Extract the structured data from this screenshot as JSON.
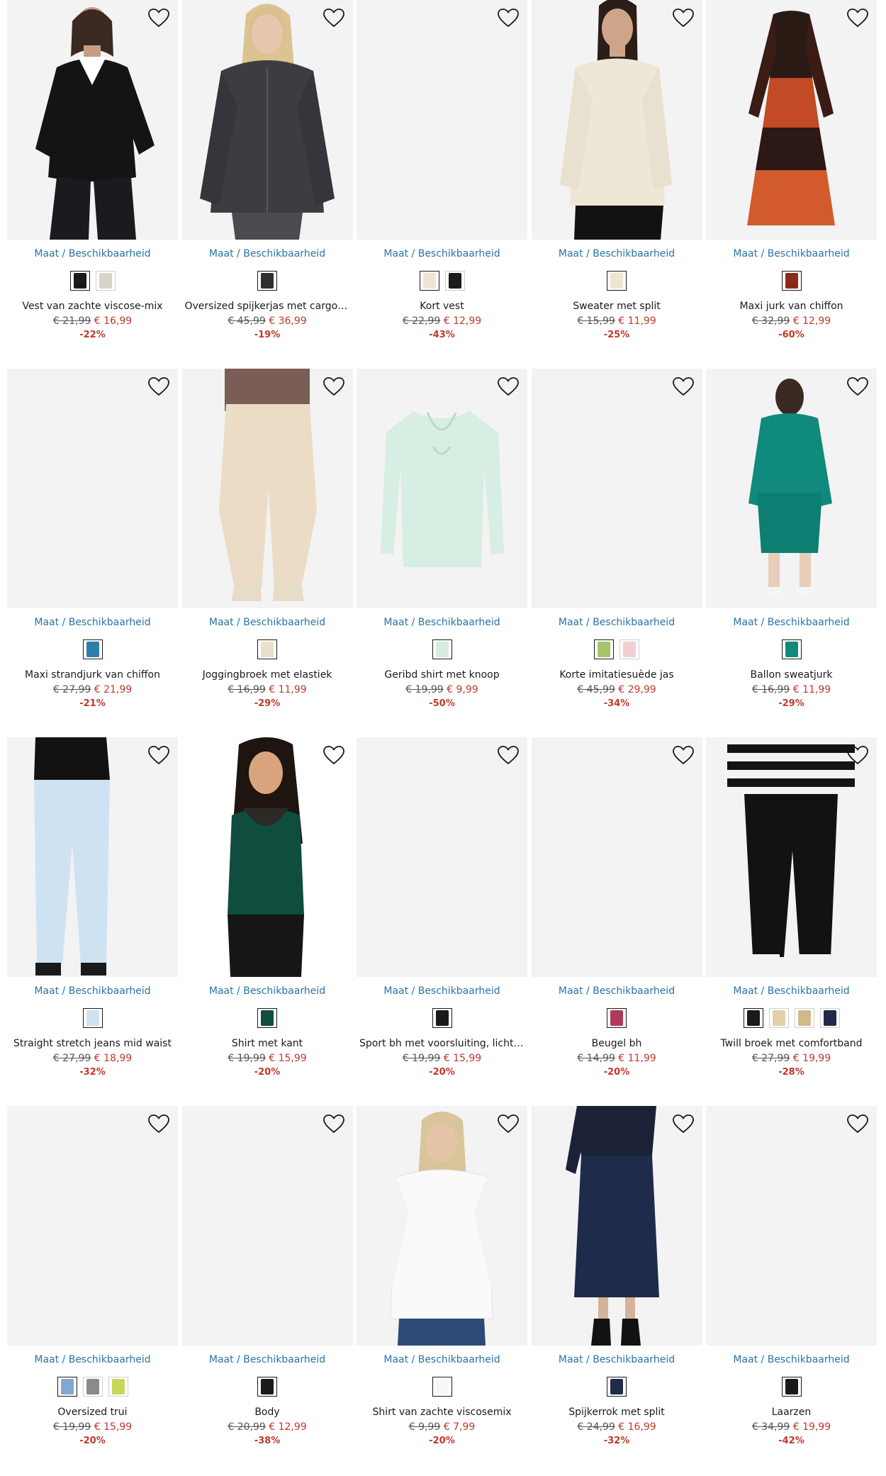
{
  "common": {
    "size_link": "Maat / Beschikbaarheid"
  },
  "products": [
    {
      "title": "Vest van zachte viscose-mix",
      "old": "€ 21,99",
      "new": "€ 16,99",
      "discount": "-22%",
      "swatches": [
        "#1a1a1a",
        "#d9d4c8"
      ],
      "photo": "cardigan-black",
      "bg": "#f3f3f3"
    },
    {
      "title": "Oversized spijkerjas met cargodetails",
      "old": "€ 45,99",
      "new": "€ 36,99",
      "discount": "-19%",
      "swatches": [
        "#2e2e30"
      ],
      "photo": "denim-jacket",
      "bg": "#f3f3f3"
    },
    {
      "title": "Kort vest",
      "old": "€ 22,99",
      "new": "€ 12,99",
      "discount": "-43%",
      "swatches": [
        "#efe4cf",
        "#1a1a1a"
      ],
      "photo": "empty",
      "bg": "#f3f3f3"
    },
    {
      "title": "Sweater met split",
      "old": "€ 15,99",
      "new": "€ 11,99",
      "discount": "-25%",
      "swatches": [
        "#eee6d2"
      ],
      "photo": "sweater-cream",
      "bg": "#f3f3f3"
    },
    {
      "title": "Maxi jurk van chiffon",
      "old": "€ 32,99",
      "new": "€ 12,99",
      "discount": "-60%",
      "swatches": [
        "#8b2a16"
      ],
      "photo": "maxi-dress-red",
      "bg": "#f3f3f3"
    },
    {
      "title": "Maxi strandjurk van chiffon",
      "old": "€ 27,99",
      "new": "€ 21,99",
      "discount": "-21%",
      "swatches": [
        "#2f7ea8"
      ],
      "photo": "empty",
      "bg": "#f3f3f3"
    },
    {
      "title": "Joggingbroek met elastiek",
      "old": "€ 16,99",
      "new": "€ 11,99",
      "discount": "-29%",
      "swatches": [
        "#eadfcc"
      ],
      "photo": "jogging-beige",
      "bg": "#f3f3f3"
    },
    {
      "title": "Geribd shirt met knoop",
      "old": "€ 19,99",
      "new": "€ 9,99",
      "discount": "-50%",
      "swatches": [
        "#d6ede0"
      ],
      "photo": "mint-shirt",
      "bg": "#f3f3f3"
    },
    {
      "title": "Korte imitatiesuède jas",
      "old": "€ 45,99",
      "new": "€ 29,99",
      "discount": "-34%",
      "swatches": [
        "#a8c46a",
        "#f2cfd2"
      ],
      "photo": "empty",
      "bg": "#f3f3f3"
    },
    {
      "title": "Ballon sweatjurk",
      "old": "€ 16,99",
      "new": "€ 11,99",
      "discount": "-29%",
      "swatches": [
        "#0f8a7c"
      ],
      "photo": "teal-dress",
      "bg": "#f3f3f3"
    },
    {
      "title": "Straight stretch jeans mid waist",
      "old": "€ 27,99",
      "new": "€ 18,99",
      "discount": "-32%",
      "swatches": [
        "#cfe2f2"
      ],
      "photo": "jeans-light",
      "bg": "#f3f3f3"
    },
    {
      "title": "Shirt met kant",
      "old": "€ 19,99",
      "new": "€ 15,99",
      "discount": "-20%",
      "swatches": [
        "#0f4d3f"
      ],
      "photo": "lace-top",
      "bg": "#ffffff"
    },
    {
      "title": "Sport bh met voorsluiting, lichte steun",
      "old": "€ 19,99",
      "new": "€ 15,99",
      "discount": "-20%",
      "swatches": [
        "#1a1a1a"
      ],
      "photo": "empty",
      "bg": "#f3f3f3"
    },
    {
      "title": "Beugel bh",
      "old": "€ 14,99",
      "new": "€ 11,99",
      "discount": "-20%",
      "swatches": [
        "#b03a5c"
      ],
      "photo": "empty",
      "bg": "#f3f3f3"
    },
    {
      "title": "Twill broek met comfortband",
      "old": "€ 27,99",
      "new": "€ 19,99",
      "discount": "-28%",
      "swatches": [
        "#1a1a1a",
        "#e3cfa9",
        "#d2b98a",
        "#1f2a4a"
      ],
      "photo": "twill-black",
      "bg": "#f3f3f3"
    },
    {
      "title": "Oversized trui",
      "old": "€ 19,99",
      "new": "€ 15,99",
      "discount": "-20%",
      "swatches": [
        "#7fa8d3",
        "#8a8a8a",
        "#c9d65a"
      ],
      "photo": "empty",
      "bg": "#f3f3f3"
    },
    {
      "title": "Body",
      "old": "€ 20,99",
      "new": "€ 12,99",
      "discount": "-38%",
      "swatches": [
        "#1a1a1a"
      ],
      "photo": "empty",
      "bg": "#f3f3f3"
    },
    {
      "title": "Shirt van zachte viscosemix",
      "old": "€ 9,99",
      "new": "€ 7,99",
      "discount": "-20%",
      "swatches": [
        "#f7f7f7"
      ],
      "photo": "white-shirt",
      "bg": "#f3f3f3"
    },
    {
      "title": "Spijkerrok met split",
      "old": "€ 24,99",
      "new": "€ 16,99",
      "discount": "-32%",
      "swatches": [
        "#1e2b4a"
      ],
      "photo": "denim-skirt",
      "bg": "#f3f3f3"
    },
    {
      "title": "Laarzen",
      "old": "€ 34,99",
      "new": "€ 19,99",
      "discount": "-42%",
      "swatches": [
        "#1a1a1a"
      ],
      "photo": "empty",
      "bg": "#f3f3f3"
    }
  ]
}
